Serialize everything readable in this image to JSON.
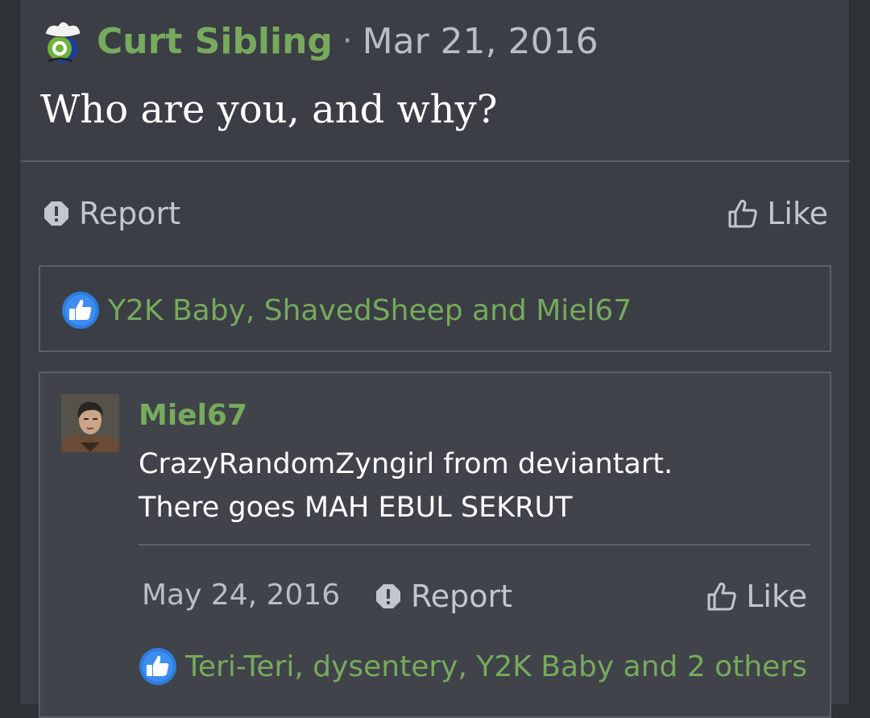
{
  "post": {
    "author": "Curt Sibling",
    "separator": "·",
    "date": "Mar 21, 2016",
    "body": "Who are you, and why?",
    "report_label": "Report",
    "like_label": "Like",
    "reactions": "Y2K Baby, ShavedSheep and Miel67"
  },
  "reply": {
    "author": "Miel67",
    "lines": [
      "CrazyRandomZyngirl from deviantart.",
      "There goes MAH EBUL SEKRUT"
    ],
    "date": "May 24, 2016",
    "report_label": "Report",
    "like_label": "Like",
    "reactions": "Teri-Teri, dysentery, Y2K Baby and 2 others"
  },
  "colors": {
    "background": "#2f3237",
    "panel": "#3b3e45",
    "username": "#77aa5c",
    "like_badge": "#2d7de0"
  },
  "icons": {
    "author_avatar": "cowboy-hat-avatar-icon",
    "reply_avatar": "user-portrait-avatar",
    "report": "exclamation-octagon-icon",
    "like": "thumbs-up-outline-icon",
    "reaction": "thumbs-up-badge-icon"
  }
}
